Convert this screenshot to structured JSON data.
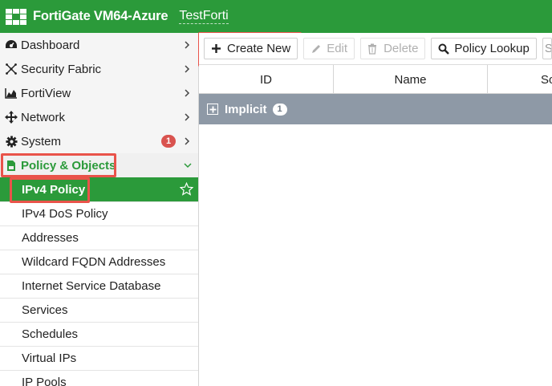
{
  "header": {
    "app_title": "FortiGate VM64-Azure",
    "vdom_name": "TestForti",
    "bg_color": "#2b9a3a"
  },
  "sidebar": {
    "items": [
      {
        "label": "Dashboard",
        "icon": "dashboard-icon"
      },
      {
        "label": "Security Fabric",
        "icon": "security-fabric-icon"
      },
      {
        "label": "FortiView",
        "icon": "fortiview-icon"
      },
      {
        "label": "Network",
        "icon": "network-icon"
      },
      {
        "label": "System",
        "icon": "gear-icon",
        "badge": "1"
      },
      {
        "label": "Policy & Objects",
        "icon": "policy-icon",
        "expanded": true
      }
    ],
    "sub_items": [
      {
        "label": "IPv4 Policy",
        "active": true
      },
      {
        "label": "IPv4 DoS Policy"
      },
      {
        "label": "Addresses"
      },
      {
        "label": "Wildcard FQDN Addresses"
      },
      {
        "label": "Internet Service Database"
      },
      {
        "label": "Services"
      },
      {
        "label": "Schedules"
      },
      {
        "label": "Virtual IPs"
      },
      {
        "label": "IP Pools"
      }
    ]
  },
  "toolbar": {
    "create_new": "Create New",
    "edit": "Edit",
    "delete": "Delete",
    "policy_lookup": "Policy Lookup",
    "search_partial": "S"
  },
  "table": {
    "columns": [
      "ID",
      "Name",
      "So"
    ],
    "groups": [
      {
        "label": "Implicit",
        "count": "1"
      }
    ]
  },
  "colors": {
    "accent": "#2b9a3a",
    "highlight_box": "#e9534a",
    "group_row": "#8e99a6",
    "badge": "#d9534f"
  }
}
